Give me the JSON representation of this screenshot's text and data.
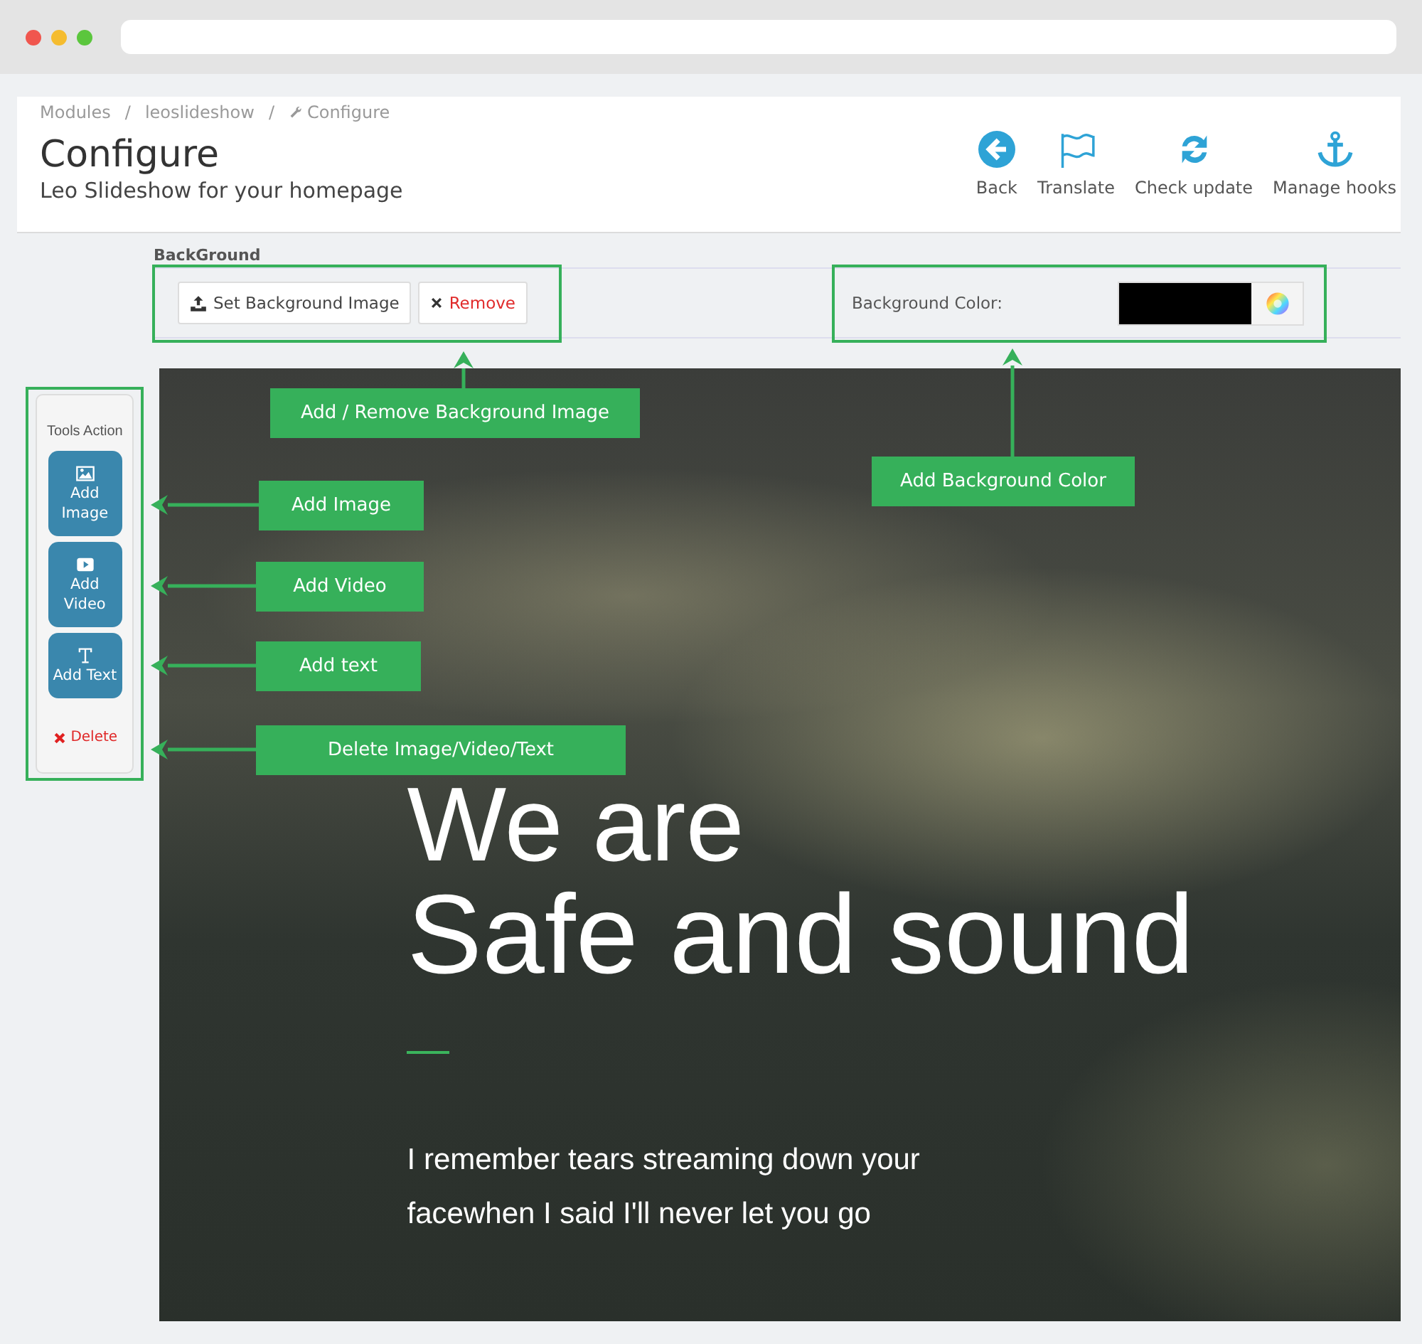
{
  "breadcrumb": {
    "separator": "/",
    "items": [
      {
        "label": "Modules",
        "kind": "plain"
      },
      {
        "label": "leoslideshow",
        "kind": "plain"
      },
      {
        "label": "Configure",
        "kind": "wrench"
      }
    ]
  },
  "page_title": "Configure",
  "subtitle": "Leo Slideshow for your homepage",
  "toolbar": [
    {
      "label": "Back",
      "kind": "back"
    },
    {
      "label": "Translate",
      "kind": "flag"
    },
    {
      "label": "Check update",
      "kind": "refresh"
    },
    {
      "label": "Manage hooks",
      "kind": "anchor"
    }
  ],
  "background": {
    "title": "BackGround",
    "buttons": [
      {
        "label": "Set Background Image",
        "kind": "upload"
      },
      {
        "label": "Remove",
        "kind": "remove"
      }
    ],
    "color_label": "Background Color:",
    "swatch": {
      "color": "#000000"
    }
  },
  "tools": {
    "title": "Tools Action",
    "items": [
      {
        "label": "Add Image",
        "kind": "image"
      },
      {
        "label": "Add Video",
        "kind": "video"
      },
      {
        "label": "Add Text",
        "kind": "text"
      }
    ],
    "delete": "Delete"
  },
  "slide": {
    "heading": [
      "We are",
      "Safe and sound"
    ],
    "paragraph": [
      "I remember tears streaming down your",
      "facewhen I said I'll never let you go"
    ]
  },
  "callouts": [
    {
      "text": "Add / Remove Background Image"
    },
    {
      "text": "Add Background Color"
    },
    {
      "text": "Add Image"
    },
    {
      "text": "Add Video"
    },
    {
      "text": "Add text"
    },
    {
      "text": "Delete Image/Video/Text"
    }
  ]
}
